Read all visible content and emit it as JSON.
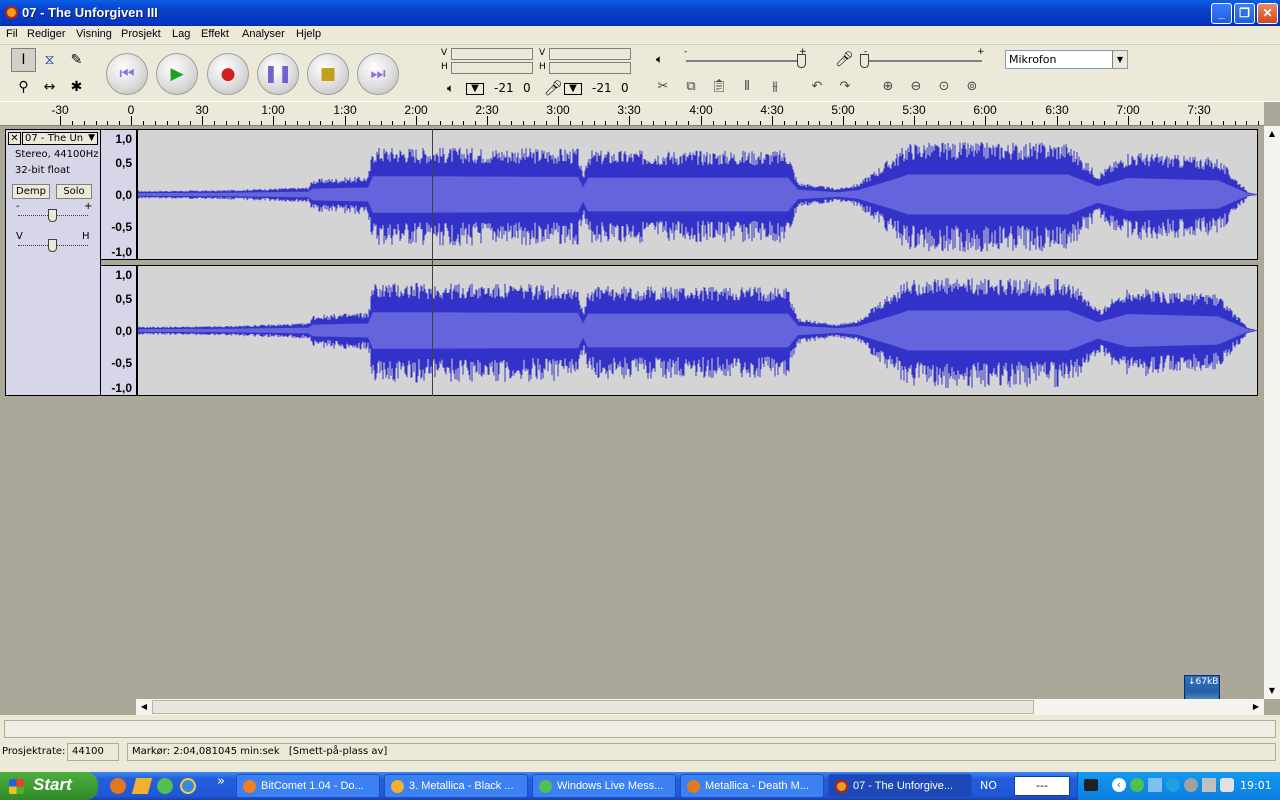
{
  "window": {
    "title": "07 - The Unforgiven III"
  },
  "menu": [
    "Fil",
    "Rediger",
    "Visning",
    "Prosjekt",
    "Lag",
    "Effekt",
    "Analyser",
    "Hjelp"
  ],
  "meters": {
    "out_v": "V",
    "out_h": "H",
    "in_v": "V",
    "in_h": "H",
    "out_db": "-21",
    "out_zero": "0",
    "in_db": "-21",
    "in_zero": "0"
  },
  "mixer": {
    "minus": "-",
    "plus": "+"
  },
  "input_source": "Mikrofon",
  "ruler": [
    "-30",
    "0",
    "30",
    "1:00",
    "1:30",
    "2:00",
    "2:30",
    "3:00",
    "3:30",
    "4:00",
    "4:30",
    "5:00",
    "5:30",
    "6:00",
    "6:30",
    "7:00",
    "7:30"
  ],
  "track": {
    "name": "07 - The Un",
    "format": "Stereo, 44100Hz",
    "bits": "32-bit float",
    "mute": "Demp",
    "solo": "Solo",
    "gain_minus": "-",
    "gain_plus": "+",
    "pan_left": "V",
    "pan_right": "H",
    "scale": [
      "1,0",
      "0,5",
      "0,0",
      "-0,5",
      "-1,0"
    ]
  },
  "status": {
    "rate_label": "Prosjektrate:",
    "rate_value": "44100",
    "cursor": "Markør: 2:04,081045 min:sek",
    "snap": "[Smett-på-plass av]"
  },
  "net_widget": "↓67kB",
  "taskbar": {
    "start": "Start",
    "chevron": "»",
    "tasks": [
      "BitComet 1.04 - Do...",
      "3. Metallica - Black ...",
      "Windows Live Mess...",
      "Metallica - Death M...",
      "07 - The Unforgive..."
    ],
    "lang": "NO",
    "field": "---",
    "time": "19:01"
  },
  "colors": {
    "waveform": "#3232C8",
    "waveform_rms": "#6464DC",
    "track_bg": "#D4D4D4",
    "panel": "#D6D6E8",
    "title_blue": "#0A3FC8",
    "start_green": "#3A9A30"
  },
  "icons": [
    "audacity-icon",
    "minimize-icon",
    "maximize-icon",
    "close-icon",
    "select-tool-icon",
    "envelope-tool-icon",
    "draw-tool-icon",
    "zoom-tool-icon",
    "timeshift-tool-icon",
    "multi-tool-icon",
    "skip-start-icon",
    "play-icon",
    "record-icon",
    "pause-icon",
    "stop-icon",
    "skip-end-icon",
    "speaker-icon",
    "microphone-icon",
    "cut-icon",
    "copy-icon",
    "paste-icon",
    "trim-icon",
    "silence-icon",
    "undo-icon",
    "redo-icon",
    "zoom-in-icon",
    "zoom-out-icon",
    "fit-selection-icon",
    "fit-project-icon"
  ]
}
